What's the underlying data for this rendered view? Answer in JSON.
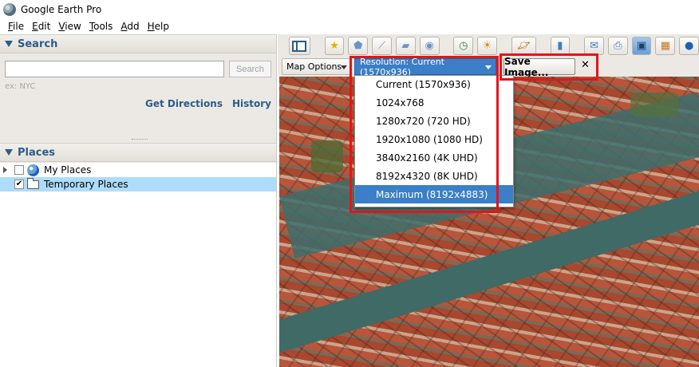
{
  "window": {
    "title": "Google Earth Pro"
  },
  "menu": [
    "File",
    "Edit",
    "View",
    "Tools",
    "Add",
    "Help"
  ],
  "search": {
    "header": "Search",
    "input_value": "",
    "button": "Search",
    "hint": "ex: NYC",
    "links": {
      "directions": "Get Directions",
      "history": "History"
    }
  },
  "places": {
    "header": "Places",
    "items": [
      {
        "label": "My Places",
        "checked": false,
        "icon": "globe-icon"
      },
      {
        "label": "Temporary Places",
        "checked": true,
        "icon": "folder-icon"
      }
    ]
  },
  "toolbar": {
    "icons": [
      "sidebar-icon",
      "placemark-icon",
      "polygon-icon",
      "path-icon",
      "overlay-icon",
      "tour-icon",
      "historical-imagery-icon",
      "sunlight-icon",
      "planets-icon",
      "ruler-icon",
      "email-icon",
      "print-icon",
      "save-image-icon",
      "view-maps-icon",
      "earth-icon"
    ]
  },
  "image_bar": {
    "map_options": "Map Options",
    "resolution_selected": "Resolution: Current (1570x936)",
    "save_button": "Save Image...",
    "close": "✕"
  },
  "resolution_options": [
    "Current (1570x936)",
    "1024x768",
    "1280x720 (720 HD)",
    "1920x1080 (1080 HD)",
    "3840x2160 (4K UHD)",
    "8192x4320 (8K UHD)",
    "Maximum (8192x4883)"
  ],
  "highlighted_option": "Maximum (8192x4883)",
  "colors": {
    "accent": "#3a7fc7",
    "highlight_box": "#e3151a",
    "link": "#2b5d8a"
  }
}
